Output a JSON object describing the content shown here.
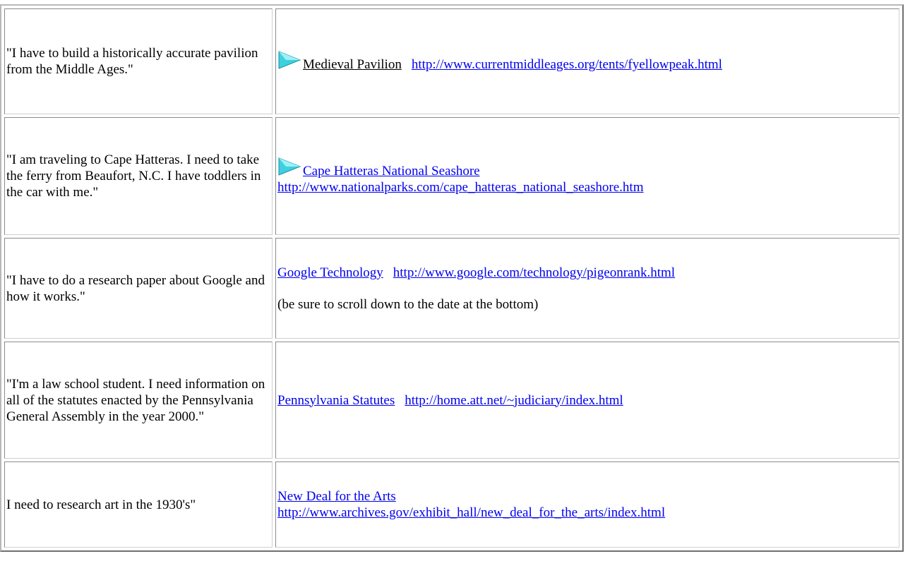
{
  "rows": [
    {
      "question": "\"I have to build a historically accurate pavilion from the Middle Ages.\"",
      "link_text": "Medieval Pavilion",
      "url": "http://www.currentmiddleages.org/tents/fyellowpeak.html",
      "icon": "arrow-icon"
    },
    {
      "question": "\"I am traveling to Cape Hatteras. I need to take the ferry from Beaufort, N.C. I have toddlers in the car with me.\"",
      "link_text": "Cape Hatteras National Seashore",
      "url": "http://www.nationalparks.com/cape_hatteras_national_seashore.htm",
      "icon": "arrow-icon"
    },
    {
      "question": "\"I have to do a research paper about Google and how it works.\"",
      "link_text": "Google Technology",
      "url": "http://www.google.com/technology/pigeonrank.html",
      "note": "(be sure to scroll down to the date at the bottom)"
    },
    {
      "question": "\"I'm a law school student. I need information on all of the statutes enacted by the Pennsylvania General Assembly in the year 2000.\"",
      "link_text": "Pennsylvania Statutes",
      "url": "http://home.att.net/~judiciary/index.html"
    },
    {
      "question": "I need to research art in the 1930's\"",
      "link_text": "New Deal for the Arts",
      "url": "http://www.archives.gov/exhibit_hall/new_deal_for_the_arts/index.html"
    }
  ],
  "colors": {
    "link": "#0000ee",
    "icon_fill": "#3fd0e0"
  }
}
